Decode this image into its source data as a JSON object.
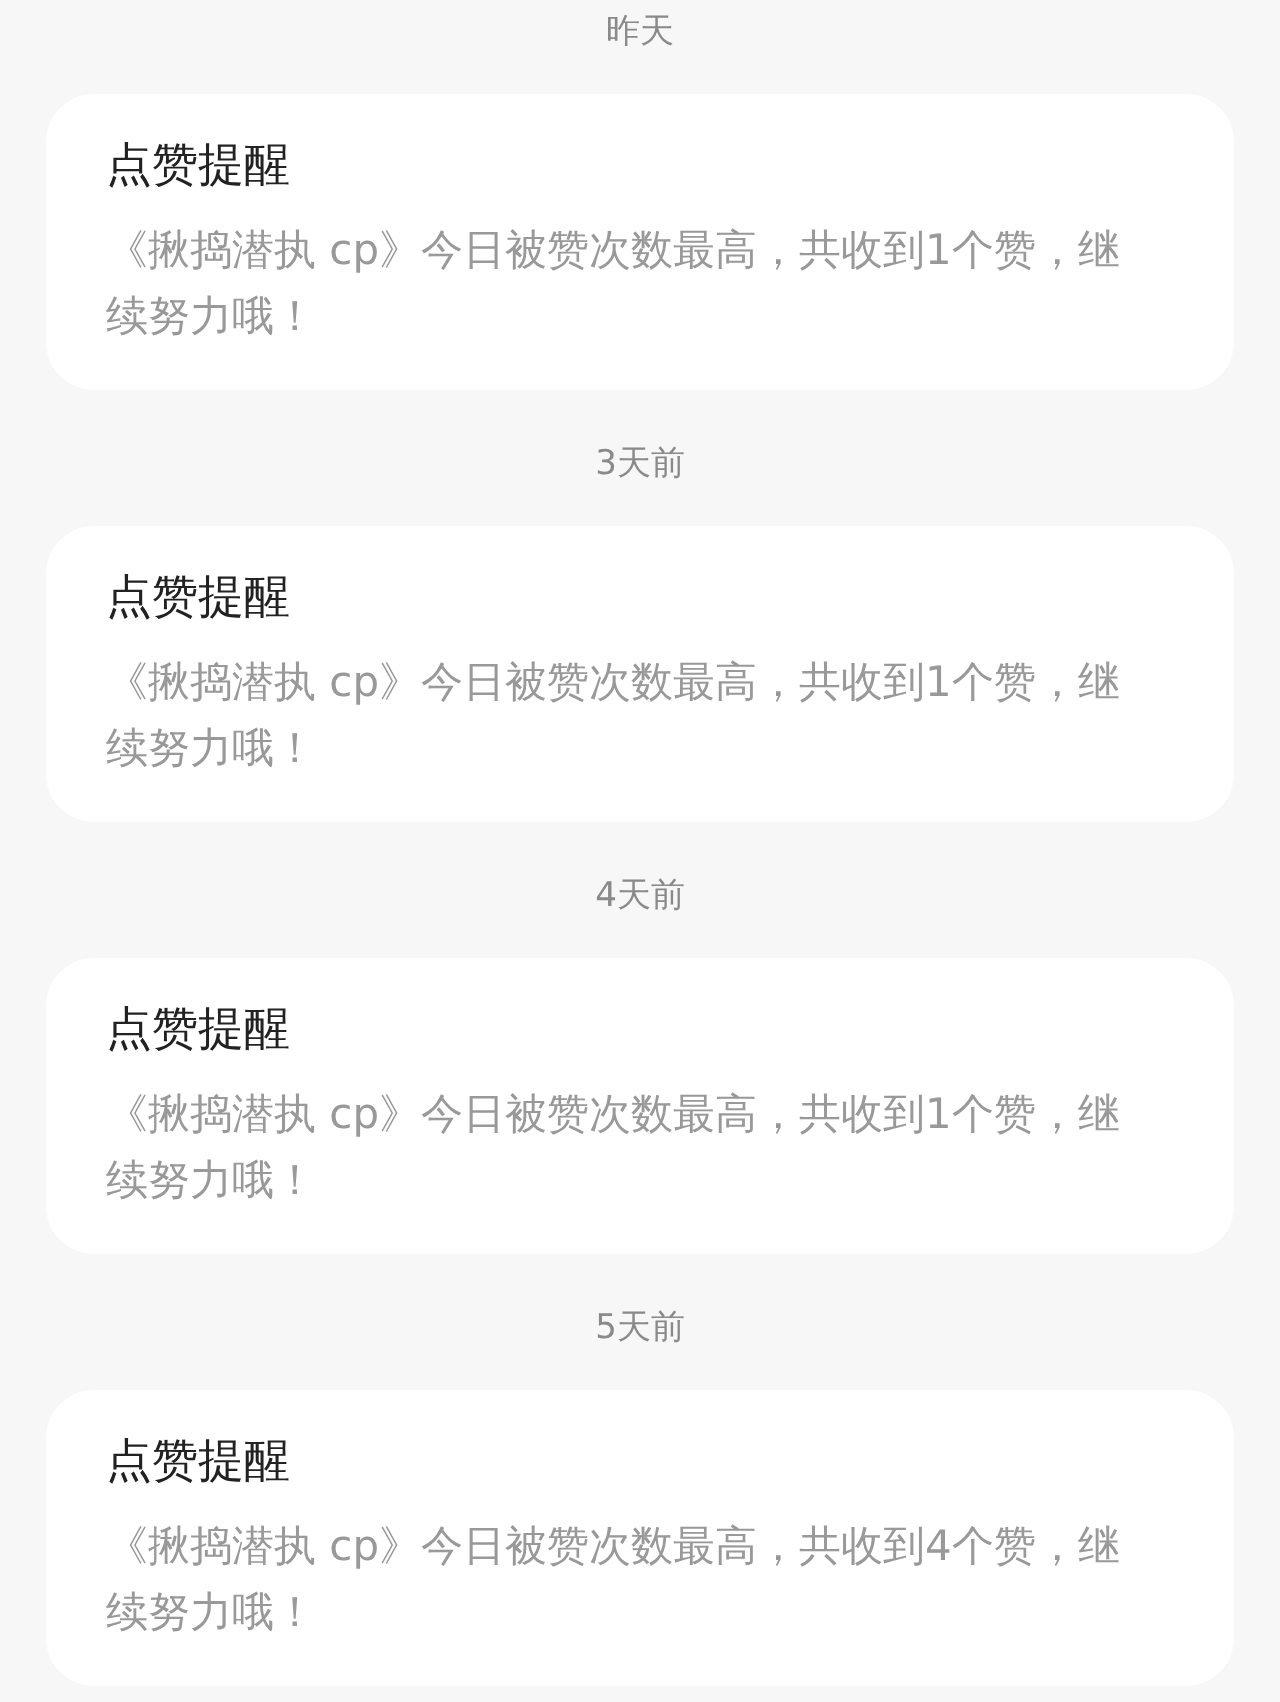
{
  "notifications": [
    {
      "date": "昨天",
      "title": "点赞提醒",
      "message": "《揪捣潜执 cp》今日被赞次数最高，共收到1个赞，继续努力哦！"
    },
    {
      "date": "3天前",
      "title": "点赞提醒",
      "message": "《揪捣潜执 cp》今日被赞次数最高，共收到1个赞，继续努力哦！"
    },
    {
      "date": "4天前",
      "title": "点赞提醒",
      "message": "《揪捣潜执 cp》今日被赞次数最高，共收到1个赞，继续努力哦！"
    },
    {
      "date": "5天前",
      "title": "点赞提醒",
      "message": "《揪捣潜执 cp》今日被赞次数最高，共收到4个赞，继续努力哦！"
    }
  ]
}
